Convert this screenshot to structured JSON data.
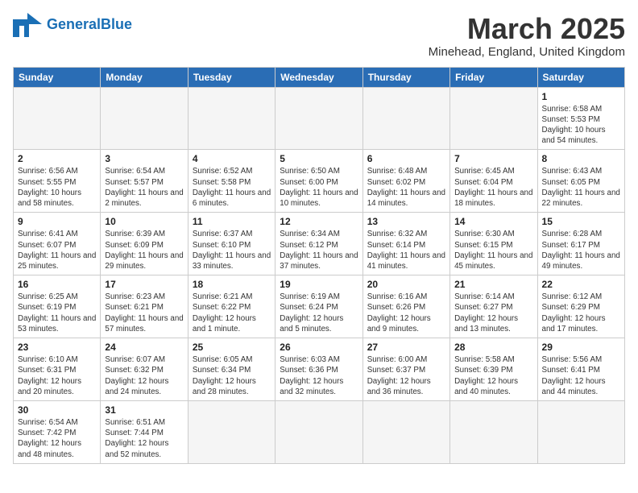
{
  "header": {
    "logo_general": "General",
    "logo_blue": "Blue",
    "month_title": "March 2025",
    "location": "Minehead, England, United Kingdom"
  },
  "weekdays": [
    "Sunday",
    "Monday",
    "Tuesday",
    "Wednesday",
    "Thursday",
    "Friday",
    "Saturday"
  ],
  "weeks": [
    [
      {
        "day": "",
        "info": ""
      },
      {
        "day": "",
        "info": ""
      },
      {
        "day": "",
        "info": ""
      },
      {
        "day": "",
        "info": ""
      },
      {
        "day": "",
        "info": ""
      },
      {
        "day": "",
        "info": ""
      },
      {
        "day": "1",
        "info": "Sunrise: 6:58 AM\nSunset: 5:53 PM\nDaylight: 10 hours\nand 54 minutes."
      }
    ],
    [
      {
        "day": "2",
        "info": "Sunrise: 6:56 AM\nSunset: 5:55 PM\nDaylight: 10 hours\nand 58 minutes."
      },
      {
        "day": "3",
        "info": "Sunrise: 6:54 AM\nSunset: 5:57 PM\nDaylight: 11 hours\nand 2 minutes."
      },
      {
        "day": "4",
        "info": "Sunrise: 6:52 AM\nSunset: 5:58 PM\nDaylight: 11 hours\nand 6 minutes."
      },
      {
        "day": "5",
        "info": "Sunrise: 6:50 AM\nSunset: 6:00 PM\nDaylight: 11 hours\nand 10 minutes."
      },
      {
        "day": "6",
        "info": "Sunrise: 6:48 AM\nSunset: 6:02 PM\nDaylight: 11 hours\nand 14 minutes."
      },
      {
        "day": "7",
        "info": "Sunrise: 6:45 AM\nSunset: 6:04 PM\nDaylight: 11 hours\nand 18 minutes."
      },
      {
        "day": "8",
        "info": "Sunrise: 6:43 AM\nSunset: 6:05 PM\nDaylight: 11 hours\nand 22 minutes."
      }
    ],
    [
      {
        "day": "9",
        "info": "Sunrise: 6:41 AM\nSunset: 6:07 PM\nDaylight: 11 hours\nand 25 minutes."
      },
      {
        "day": "10",
        "info": "Sunrise: 6:39 AM\nSunset: 6:09 PM\nDaylight: 11 hours\nand 29 minutes."
      },
      {
        "day": "11",
        "info": "Sunrise: 6:37 AM\nSunset: 6:10 PM\nDaylight: 11 hours\nand 33 minutes."
      },
      {
        "day": "12",
        "info": "Sunrise: 6:34 AM\nSunset: 6:12 PM\nDaylight: 11 hours\nand 37 minutes."
      },
      {
        "day": "13",
        "info": "Sunrise: 6:32 AM\nSunset: 6:14 PM\nDaylight: 11 hours\nand 41 minutes."
      },
      {
        "day": "14",
        "info": "Sunrise: 6:30 AM\nSunset: 6:15 PM\nDaylight: 11 hours\nand 45 minutes."
      },
      {
        "day": "15",
        "info": "Sunrise: 6:28 AM\nSunset: 6:17 PM\nDaylight: 11 hours\nand 49 minutes."
      }
    ],
    [
      {
        "day": "16",
        "info": "Sunrise: 6:25 AM\nSunset: 6:19 PM\nDaylight: 11 hours\nand 53 minutes."
      },
      {
        "day": "17",
        "info": "Sunrise: 6:23 AM\nSunset: 6:21 PM\nDaylight: 11 hours\nand 57 minutes."
      },
      {
        "day": "18",
        "info": "Sunrise: 6:21 AM\nSunset: 6:22 PM\nDaylight: 12 hours\nand 1 minute."
      },
      {
        "day": "19",
        "info": "Sunrise: 6:19 AM\nSunset: 6:24 PM\nDaylight: 12 hours\nand 5 minutes."
      },
      {
        "day": "20",
        "info": "Sunrise: 6:16 AM\nSunset: 6:26 PM\nDaylight: 12 hours\nand 9 minutes."
      },
      {
        "day": "21",
        "info": "Sunrise: 6:14 AM\nSunset: 6:27 PM\nDaylight: 12 hours\nand 13 minutes."
      },
      {
        "day": "22",
        "info": "Sunrise: 6:12 AM\nSunset: 6:29 PM\nDaylight: 12 hours\nand 17 minutes."
      }
    ],
    [
      {
        "day": "23",
        "info": "Sunrise: 6:10 AM\nSunset: 6:31 PM\nDaylight: 12 hours\nand 20 minutes."
      },
      {
        "day": "24",
        "info": "Sunrise: 6:07 AM\nSunset: 6:32 PM\nDaylight: 12 hours\nand 24 minutes."
      },
      {
        "day": "25",
        "info": "Sunrise: 6:05 AM\nSunset: 6:34 PM\nDaylight: 12 hours\nand 28 minutes."
      },
      {
        "day": "26",
        "info": "Sunrise: 6:03 AM\nSunset: 6:36 PM\nDaylight: 12 hours\nand 32 minutes."
      },
      {
        "day": "27",
        "info": "Sunrise: 6:00 AM\nSunset: 6:37 PM\nDaylight: 12 hours\nand 36 minutes."
      },
      {
        "day": "28",
        "info": "Sunrise: 5:58 AM\nSunset: 6:39 PM\nDaylight: 12 hours\nand 40 minutes."
      },
      {
        "day": "29",
        "info": "Sunrise: 5:56 AM\nSunset: 6:41 PM\nDaylight: 12 hours\nand 44 minutes."
      }
    ],
    [
      {
        "day": "30",
        "info": "Sunrise: 6:54 AM\nSunset: 7:42 PM\nDaylight: 12 hours\nand 48 minutes."
      },
      {
        "day": "31",
        "info": "Sunrise: 6:51 AM\nSunset: 7:44 PM\nDaylight: 12 hours\nand 52 minutes."
      },
      {
        "day": "",
        "info": ""
      },
      {
        "day": "",
        "info": ""
      },
      {
        "day": "",
        "info": ""
      },
      {
        "day": "",
        "info": ""
      },
      {
        "day": "",
        "info": ""
      }
    ]
  ]
}
